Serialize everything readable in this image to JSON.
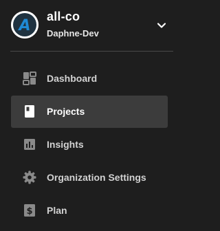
{
  "org": {
    "name": "all-co",
    "user": "Daphne-Dev",
    "logo_letter": "A",
    "toggle_icon": "chevron-down-icon"
  },
  "nav": {
    "items": [
      {
        "label": "Dashboard",
        "icon": "dashboard-icon",
        "active": false
      },
      {
        "label": "Projects",
        "icon": "projects-icon",
        "active": true
      },
      {
        "label": "Insights",
        "icon": "insights-icon",
        "active": false
      },
      {
        "label": "Organization Settings",
        "icon": "gear-icon",
        "active": false
      },
      {
        "label": "Plan",
        "icon": "dollar-icon",
        "active": false
      }
    ]
  },
  "colors": {
    "background": "#1e1e1e",
    "active_item": "#3c3c3c",
    "logo_accent": "#1f8ad6",
    "icon": "#8a8a8a",
    "divider": "#4a4a4a"
  }
}
